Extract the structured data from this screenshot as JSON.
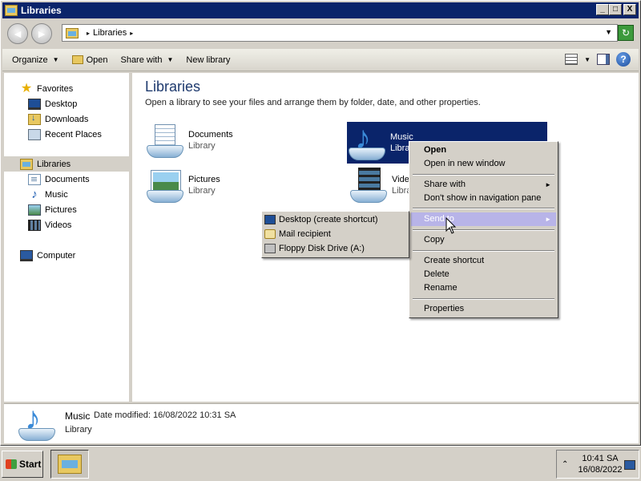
{
  "window": {
    "title": "Libraries",
    "min": "_",
    "max": "□",
    "close": "X"
  },
  "address": {
    "back": "◄",
    "forward": "►",
    "crumb": "Libraries",
    "sep": "▸",
    "drop": "▼",
    "refresh": "↻"
  },
  "commands": {
    "organize": "Organize",
    "open": "Open",
    "share_with": "Share with",
    "new_library": "New library",
    "dd": "▼",
    "help": "?"
  },
  "nav": {
    "favorites": "Favorites",
    "desktop": "Desktop",
    "downloads": "Downloads",
    "recent_places": "Recent Places",
    "libraries": "Libraries",
    "documents": "Documents",
    "music": "Music",
    "pictures": "Pictures",
    "videos": "Videos",
    "computer": "Computer"
  },
  "main": {
    "title": "Libraries",
    "subtitle": "Open a library to see your files and arrange them by folder, date, and other properties.",
    "items": [
      {
        "name": "Documents",
        "type": "Library"
      },
      {
        "name": "Music",
        "type": "Library"
      },
      {
        "name": "Pictures",
        "type": "Library"
      },
      {
        "name": "Videos",
        "type": "Library"
      }
    ]
  },
  "context_menu": {
    "open": "Open",
    "open_new_window": "Open in new window",
    "share_with": "Share with",
    "dont_show": "Don't show in navigation pane",
    "send_to": "Send to",
    "copy": "Copy",
    "create_shortcut": "Create shortcut",
    "delete": "Delete",
    "rename": "Rename",
    "properties": "Properties",
    "arrow": "►"
  },
  "send_to_menu": {
    "desktop": "Desktop (create shortcut)",
    "mail": "Mail recipient",
    "floppy": "Floppy Disk Drive (A:)"
  },
  "details": {
    "name": "Music",
    "modified_label": "Date modified:",
    "modified": "16/08/2022 10:31 SA",
    "type": "Library"
  },
  "taskbar": {
    "start": "Start",
    "time": "10:41 SA",
    "date": "16/08/2022",
    "tray_arrow": "⌃"
  },
  "colors": {
    "selection": "#0a246a",
    "menu_highlight": "#b8b4e8",
    "title_heading": "#1e3a6e",
    "face": "#d4d0c8"
  }
}
